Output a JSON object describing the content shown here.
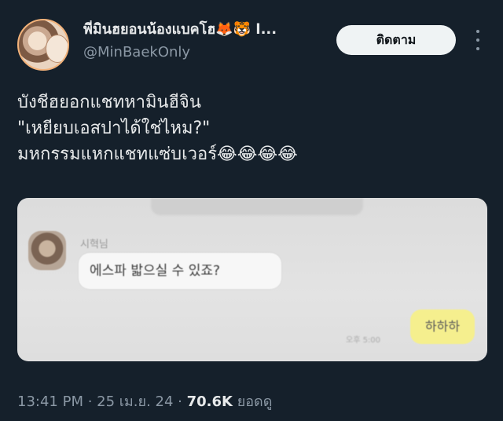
{
  "author": {
    "display_name": "พี่มินฮยอนน้องแบคโฮ🦊🐯 l...",
    "handle": "@MinBaekOnly",
    "avatar_icon": "profile-photo"
  },
  "follow_button": {
    "label": "ติดตาม"
  },
  "more_icon": "ellipsis-vertical-icon",
  "tweet": {
    "text": "บังชีฮยอกแชทหามินฮีจิน\n\"เหยียบเอสปาได้ใช่ไหม?\"\nมหกรรมแหกแชทแซ่บเวอร์😂😂😂😂"
  },
  "media": {
    "sender_name": "시혁님",
    "message_received": "에스파 밟으실 수 있죠?",
    "message_sent": "하하하",
    "time_left": "",
    "time_right": "오후 5:00"
  },
  "meta": {
    "time": "13:41 PM",
    "separator": " · ",
    "date": "25 เม.ย. 24",
    "views_count": "70.6K",
    "views_label": "ยอดดู"
  },
  "colors": {
    "background": "#15202b",
    "primary_text": "#e7e9ea",
    "secondary_text": "#8b98a5",
    "follow_button_bg": "#eff3f4"
  }
}
